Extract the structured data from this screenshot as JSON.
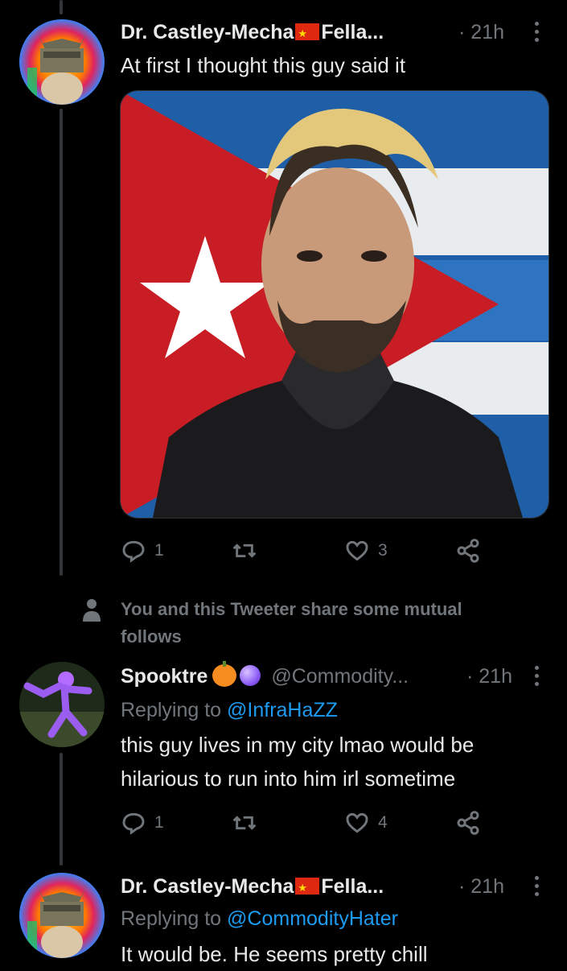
{
  "tweets": [
    {
      "name": "Dr. Castley-Mecha",
      "name_after_flag": "Fella...",
      "time": "· 21h",
      "text": "At first I thought this guy said it",
      "stats": {
        "replies": "1",
        "retweets": "",
        "likes": "3"
      }
    },
    {
      "name": "Spooktre",
      "handle": "@Commodity...",
      "time": "· 21h",
      "replying_prefix": "Replying to",
      "replying_to": "@InfraHaZZ",
      "text_line1": "this guy lives in my city lmao would be",
      "text_line2": "hilarious to run into him irl sometime",
      "stats": {
        "replies": "1",
        "retweets": "",
        "likes": "4"
      }
    },
    {
      "name": "Dr. Castley-Mecha",
      "name_after_flag": "Fella...",
      "time": "· 21h",
      "replying_prefix": "Replying to",
      "replying_to": "@CommodityHater",
      "text": "It would be. He seems pretty chill"
    }
  ],
  "notice": {
    "line1": "You and this Tweeter share some mutual",
    "line2": "follows"
  },
  "icons": [
    "reply-icon",
    "retweet-icon",
    "like-icon",
    "share-icon",
    "more-icon",
    "person-icon"
  ],
  "colors": {
    "background": "#000000",
    "text": "#e7e9ea",
    "muted": "#71767b",
    "link": "#1d9bf0"
  }
}
